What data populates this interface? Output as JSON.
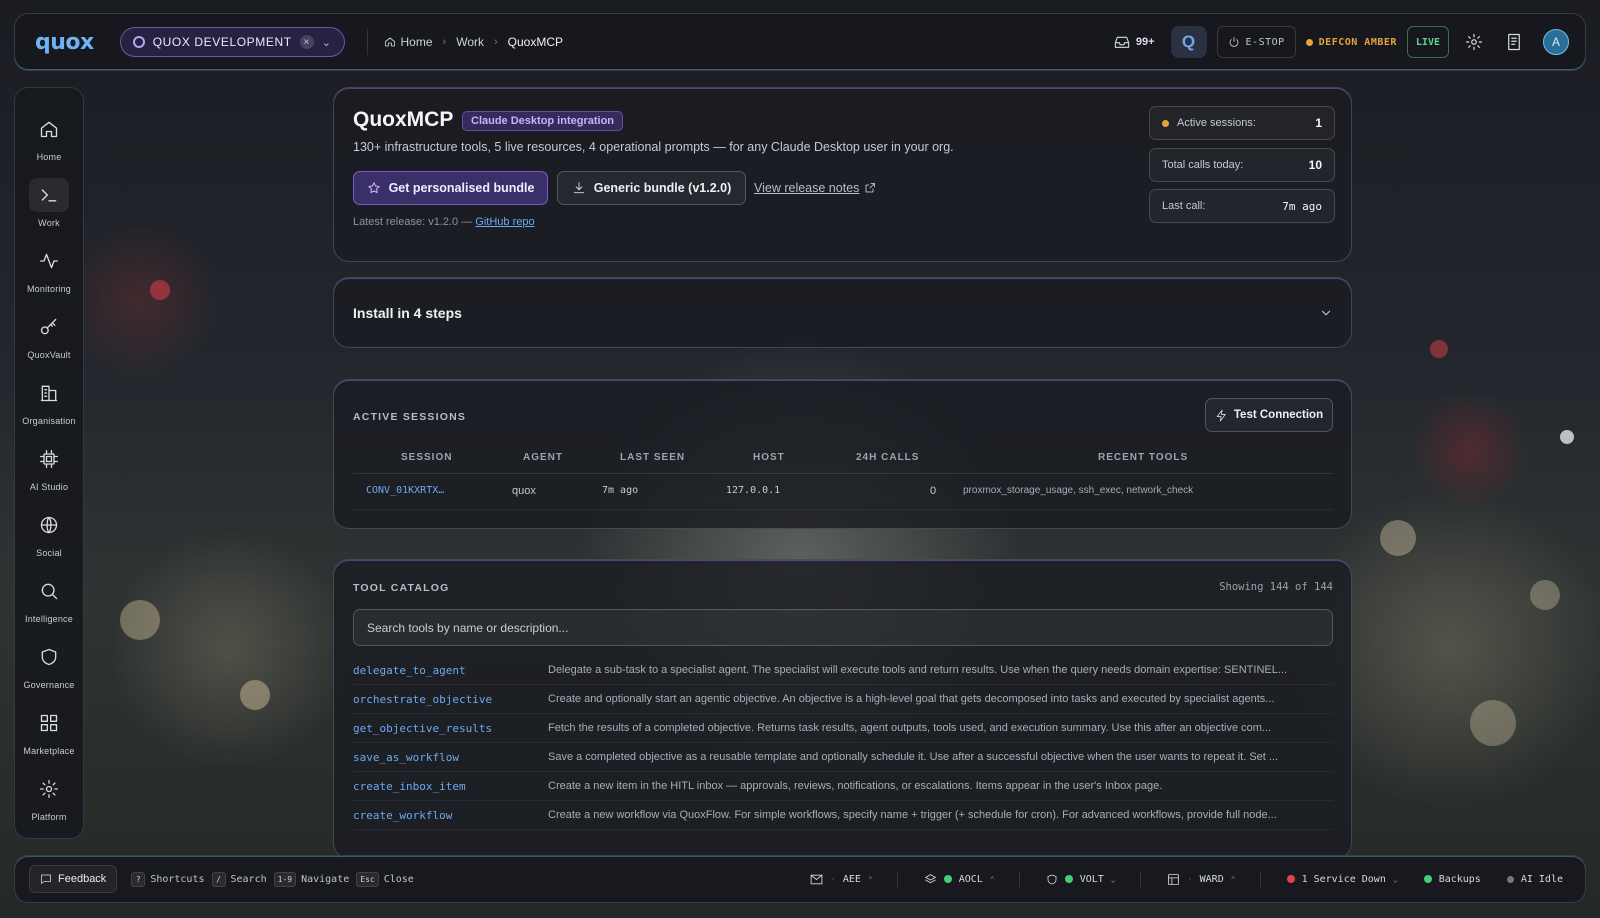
{
  "app": {
    "logo": "quox"
  },
  "workspace": {
    "name": "QUOX DEVELOPMENT",
    "close": "×",
    "chevron": "⌄"
  },
  "breadcrumb": {
    "items": [
      "Home",
      "Work",
      "QuoxMCP"
    ]
  },
  "topbar": {
    "inbox_count": "99+",
    "estop_label": "E-STOP",
    "defcon_label": "DEFCON AMBER",
    "live_label": "LIVE",
    "avatar_initial": "A",
    "q_badge": "Q"
  },
  "sidebar": {
    "items": [
      {
        "label": "Home",
        "icon": "home-icon"
      },
      {
        "label": "Work",
        "icon": "terminal-icon"
      },
      {
        "label": "Monitoring",
        "icon": "activity-icon"
      },
      {
        "label": "QuoxVault",
        "icon": "key-icon"
      },
      {
        "label": "Organisation",
        "icon": "building-icon"
      },
      {
        "label": "AI Studio",
        "icon": "cpu-icon"
      },
      {
        "label": "Social",
        "icon": "globe-icon"
      },
      {
        "label": "Intelligence",
        "icon": "search-icon"
      },
      {
        "label": "Governance",
        "icon": "shield-icon"
      },
      {
        "label": "Marketplace",
        "icon": "grid-icon"
      },
      {
        "label": "Platform",
        "icon": "gear-icon"
      }
    ]
  },
  "hero": {
    "title": "QuoxMCP",
    "badge": "Claude Desktop integration",
    "description": "130+ infrastructure tools, 5 live resources, 4 operational prompts — for any Claude Desktop user in your org.",
    "primary_button": "Get personalised bundle",
    "secondary_button": "Generic bundle (v1.2.0)",
    "release_notes_link": "View release notes",
    "release_prefix": "Latest release: v1.2.0 —",
    "github_link": "GitHub repo",
    "stats": [
      {
        "label": "Active sessions:",
        "value": "1"
      },
      {
        "label": "Total calls today:",
        "value": "10"
      },
      {
        "label": "Last call:",
        "value": "7m ago"
      }
    ]
  },
  "install": {
    "title": "Install in 4 steps"
  },
  "sessions": {
    "title": "ACTIVE SESSIONS",
    "test_button": "Test Connection",
    "columns": [
      "SESSION",
      "AGENT",
      "LAST SEEN",
      "HOST",
      "24H CALLS",
      "RECENT TOOLS"
    ],
    "rows": [
      {
        "session": "CONV_01KXRTX…",
        "agent": "quox",
        "last_seen": "7m ago",
        "host": "127.0.0.1",
        "calls": "0",
        "tools": "proxmox_storage_usage, ssh_exec, network_check"
      }
    ]
  },
  "catalog": {
    "title": "TOOL CATALOG",
    "showing": "Showing 144 of 144",
    "search_placeholder": "Search tools by name or description...",
    "tools": [
      {
        "name": "delegate_to_agent",
        "desc": "Delegate a sub-task to a specialist agent. The specialist will execute tools and return results. Use when the query needs domain expertise: SENTINEL..."
      },
      {
        "name": "orchestrate_objective",
        "desc": "Create and optionally start an agentic objective. An objective is a high-level goal that gets decomposed into tasks and executed by specialist agents..."
      },
      {
        "name": "get_objective_results",
        "desc": "Fetch the results of a completed objective. Returns task results, agent outputs, tools used, and execution summary. Use this after an objective com..."
      },
      {
        "name": "save_as_workflow",
        "desc": "Save a completed objective as a reusable template and optionally schedule it. Use after a successful objective when the user wants to repeat it. Set ..."
      },
      {
        "name": "create_inbox_item",
        "desc": "Create a new item in the HITL inbox — approvals, reviews, notifications, or escalations. Items appear in the user's Inbox page."
      },
      {
        "name": "create_workflow",
        "desc": "Create a new workflow via QuoxFlow. For simple workflows, specify name + trigger (+ schedule for cron). For advanced workflows, provide full node..."
      }
    ]
  },
  "footer": {
    "feedback": "Feedback",
    "shortcuts": [
      {
        "key": "?",
        "label": "Shortcuts"
      },
      {
        "key": "/",
        "label": "Search"
      },
      {
        "key": "1-9",
        "label": "Navigate"
      },
      {
        "key": "Esc",
        "label": "Close"
      }
    ],
    "status": {
      "aee": "AEE",
      "aocl": "AOCL",
      "volt": "VOLT",
      "ward": "WARD",
      "service": "1 Service Down",
      "backups": "Backups",
      "ai": "AI Idle"
    }
  },
  "colors": {
    "accent": "#6ea9ef",
    "brand_purple": "#8a63e0",
    "ok": "#3fcf79",
    "warn": "#e4a43a",
    "error": "#e0444f"
  }
}
